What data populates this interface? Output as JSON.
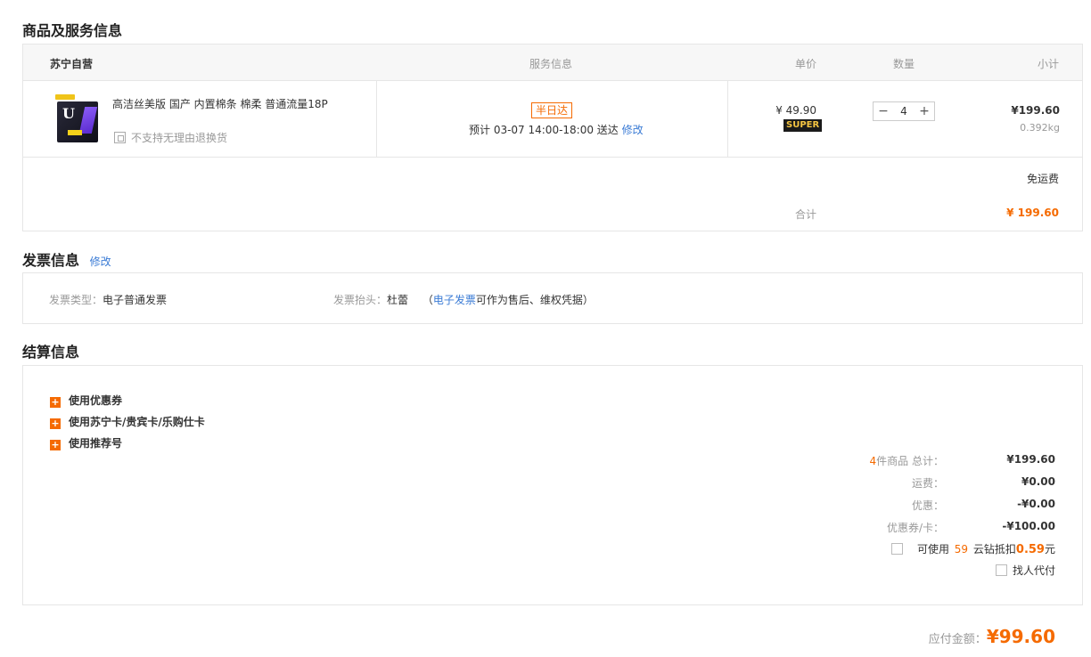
{
  "sections": {
    "goods_title": "商品及服务信息",
    "invoice_title": "发票信息",
    "invoice_edit": "修改",
    "settle_title": "结算信息"
  },
  "product_table": {
    "store": "苏宁自营",
    "col_service": "服务信息",
    "col_price": "单价",
    "col_qty": "数量",
    "col_subtotal": "小计"
  },
  "product": {
    "name": "高洁丝美版 国产 内置棉条 棉柔 普通流量18P",
    "no_return": "不支持无理由退换货",
    "service_badge": "半日达",
    "delivery_text": "预计 03-07 14:00-18:00 送达",
    "delivery_edit": "修改",
    "price": "¥ 49.90",
    "super_badge": "SUPER",
    "qty_minus": "−",
    "qty": "4",
    "qty_plus": "+",
    "subtotal": "¥199.60",
    "weight": "0.392kg"
  },
  "summary": {
    "free_shipping": "免运费",
    "total_label": "合计",
    "total_value": "¥ 199.60"
  },
  "invoice": {
    "type_label": "发票类型：",
    "type_value": "电子普通发票",
    "head_label": "发票抬头：",
    "head_value": "杜蕾",
    "note_open": "（",
    "note_link": "电子发票",
    "note_rest": "可作为售后、维权凭据",
    "note_close": "）"
  },
  "settle": {
    "options": [
      "使用优惠券",
      "使用苏宁卡/贵宾卡/乐购仕卡",
      "使用推荐号"
    ],
    "item_count": "4",
    "items_label": "件商品  总计：",
    "goods_total": "¥199.60",
    "shipping_label": "运费：",
    "shipping_value": "¥0.00",
    "discount_label": "优惠：",
    "discount_value": "-¥0.00",
    "coupon_label": "优惠券/卡：",
    "coupon_value": "-¥100.00",
    "coin_prefix": "可使用",
    "coin_count": "59",
    "coin_mid": "云钻抵扣",
    "coin_amount": "0.59",
    "coin_unit": "元",
    "proxy_label": "找人代付"
  },
  "payable": {
    "label": "应付金额：",
    "value": "¥99.60"
  },
  "colors": {
    "accent": "#f56a00",
    "link": "#3a7bd5"
  }
}
